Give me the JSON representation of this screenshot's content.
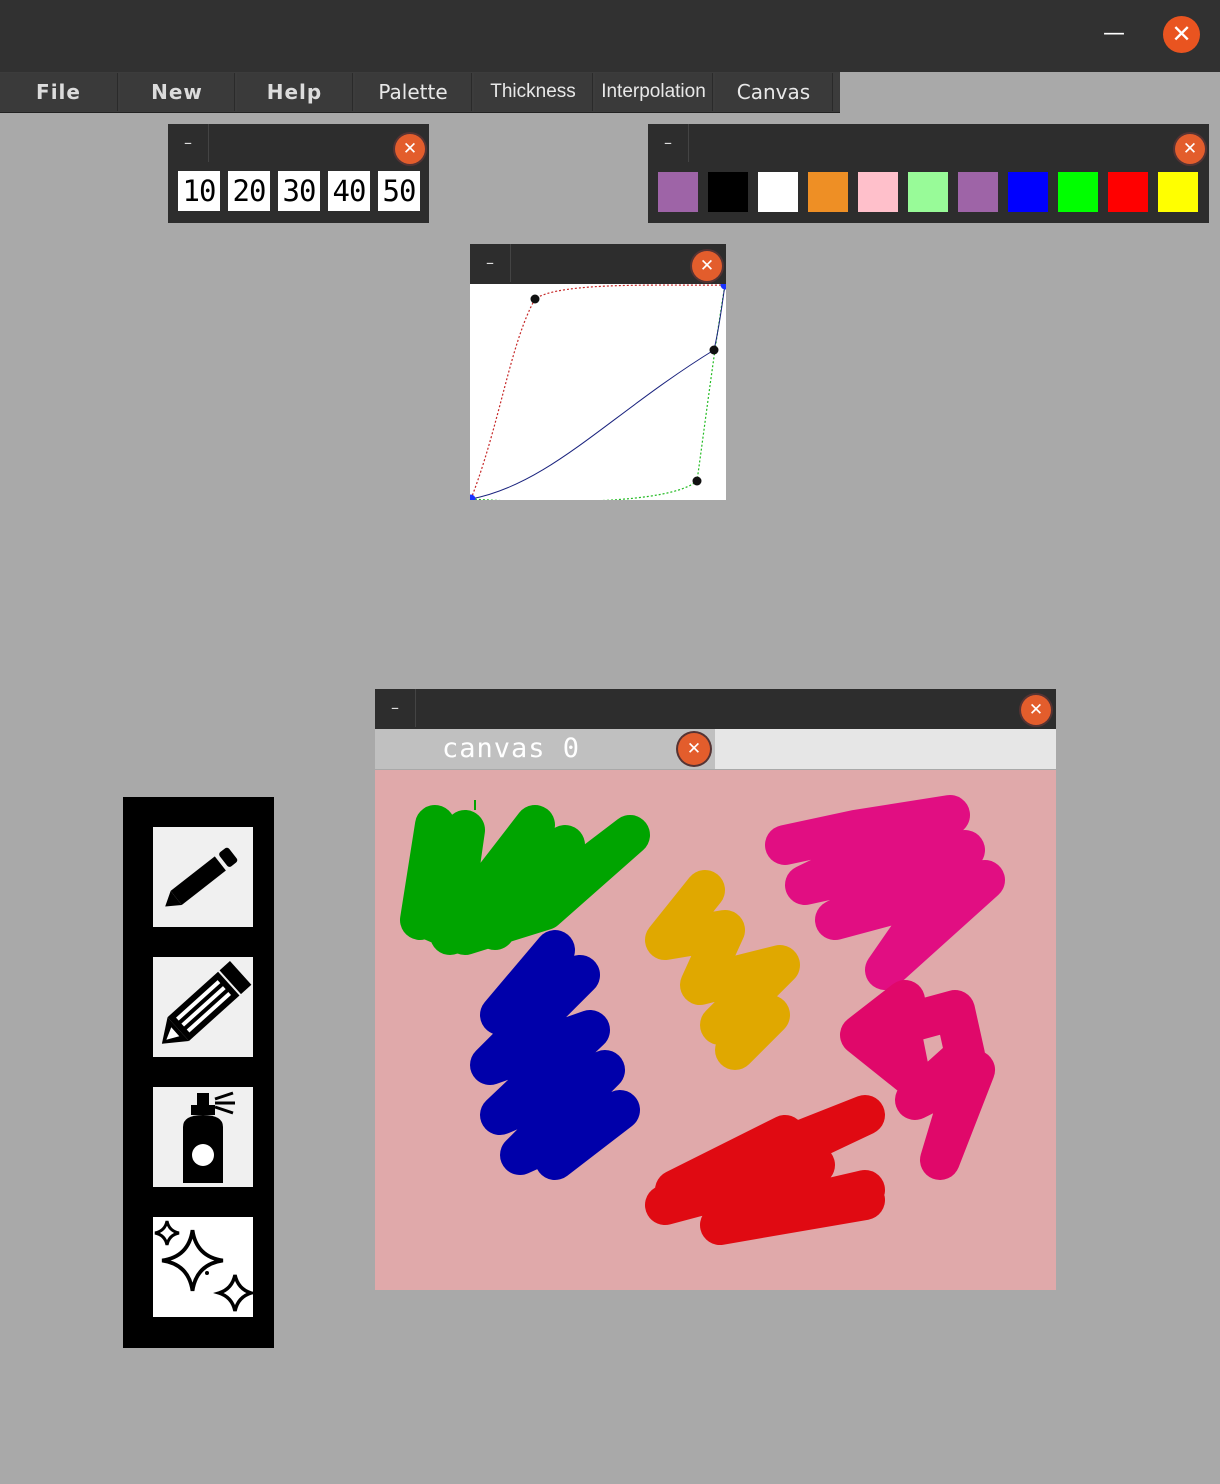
{
  "window": {
    "minimize_glyph": "—",
    "close_glyph": "✕"
  },
  "menu": [
    {
      "label": "File"
    },
    {
      "label": "New"
    },
    {
      "label": "Help"
    },
    {
      "label": "Palette"
    },
    {
      "label": "Thickness"
    },
    {
      "label": "Interpolation"
    },
    {
      "label": "Canvas"
    }
  ],
  "thickness_panel": {
    "minimize_glyph": "–",
    "close_glyph": "✕",
    "values": [
      "10",
      "20",
      "30",
      "40",
      "50"
    ]
  },
  "palette_panel": {
    "minimize_glyph": "–",
    "close_glyph": "✕",
    "colors": [
      "#9e64a7",
      "#000000",
      "#ffffff",
      "#ee8f25",
      "#ffc0cb",
      "#98fb98",
      "#9e64a7",
      "#0000ff",
      "#00ff00",
      "#ff0000",
      "#ffff00"
    ]
  },
  "interpolation_panel": {
    "minimize_glyph": "–",
    "close_glyph": "✕"
  },
  "tools": [
    {
      "name": "pencil-icon"
    },
    {
      "name": "marker-icon"
    },
    {
      "name": "spray-can-icon"
    },
    {
      "name": "sparkles-icon"
    }
  ],
  "canvas_window": {
    "minimize_glyph": "–",
    "close_glyph": "✕",
    "tab_label": "canvas 0",
    "tab_close_glyph": "✕",
    "background": "#e0a9aa",
    "stroke_colors": [
      "#00a400",
      "#0000aa",
      "#e0a800",
      "#e10e82",
      "#e0086a",
      "#e00a12"
    ]
  }
}
